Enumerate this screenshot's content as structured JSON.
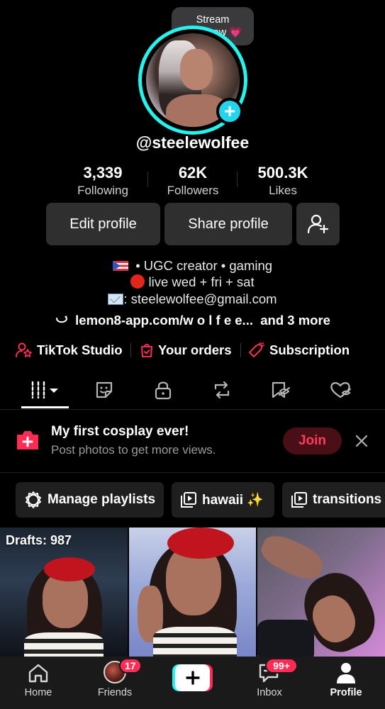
{
  "profile": {
    "username": "@steelewolfee",
    "status_bubble": {
      "line1": "Stream",
      "line2": "tomorrow",
      "emoji": "💗"
    }
  },
  "stats": [
    {
      "value": "3,339",
      "label": "Following"
    },
    {
      "value": "62K",
      "label": "Followers"
    },
    {
      "value": "500.3K",
      "label": "Likes"
    }
  ],
  "actions": {
    "edit_profile": "Edit profile",
    "share_profile": "Share profile",
    "add_friend_icon": "add-friend-icon"
  },
  "bio": {
    "line1": "• UGC creator • gaming",
    "line2": "live wed + fri + sat",
    "line3": ": steelewolfee@gmail.com",
    "link": "lemon8-app.com/w o l f e e...",
    "more": "and 3 more"
  },
  "quick_links": [
    {
      "label": "TikTok Studio",
      "icon": "studio-icon"
    },
    {
      "label": "Your orders",
      "icon": "orders-icon"
    },
    {
      "label": "Subscription",
      "icon": "subscription-icon"
    }
  ],
  "tabs": [
    {
      "name": "videos",
      "icon": "grid-icon",
      "active": true
    },
    {
      "name": "stickers",
      "icon": "sticker-icon"
    },
    {
      "name": "private",
      "icon": "lock-icon"
    },
    {
      "name": "reposts",
      "icon": "repost-icon"
    },
    {
      "name": "favorites",
      "icon": "bookmark-icon"
    },
    {
      "name": "liked",
      "icon": "heart-icon"
    }
  ],
  "banner": {
    "title": "My first cosplay ever!",
    "subtitle": "Post photos to get more views.",
    "join": "Join"
  },
  "playlists": [
    {
      "label": "Manage playlists",
      "icon": "gear-icon"
    },
    {
      "label": "hawaii ✨",
      "icon": "playlist-icon"
    },
    {
      "label": "transitions",
      "icon": "playlist-icon"
    }
  ],
  "grid": {
    "drafts_label": "Drafts: 987"
  },
  "nav": {
    "home": "Home",
    "friends": "Friends",
    "friends_badge": "17",
    "inbox": "Inbox",
    "inbox_badge": "99+",
    "profile": "Profile"
  },
  "colors": {
    "accent": "#fe2c55",
    "ring": "#25f4ee",
    "background": "#000000"
  }
}
